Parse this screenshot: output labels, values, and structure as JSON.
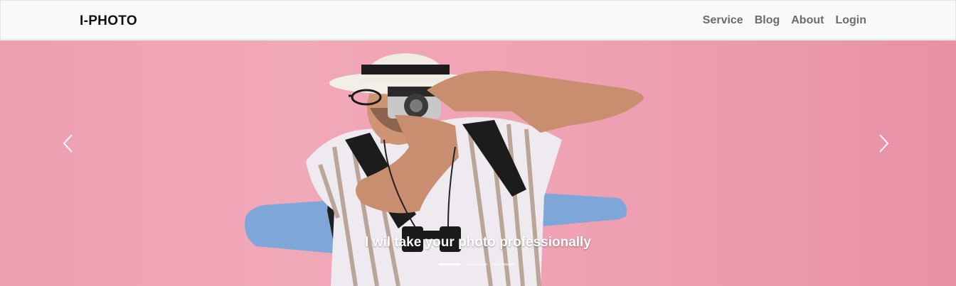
{
  "navbar": {
    "brand": "I-PHOTO",
    "links": [
      {
        "label": "Service"
      },
      {
        "label": "Blog"
      },
      {
        "label": "About"
      },
      {
        "label": "Login"
      }
    ]
  },
  "carousel": {
    "caption": "I wil take your photo professionally",
    "prev_icon": "chevron-left-icon",
    "next_icon": "chevron-right-icon",
    "active_index": 0,
    "slide_count": 3,
    "colors": {
      "background": "#f1a8b8",
      "caption": "#ffffff"
    }
  }
}
